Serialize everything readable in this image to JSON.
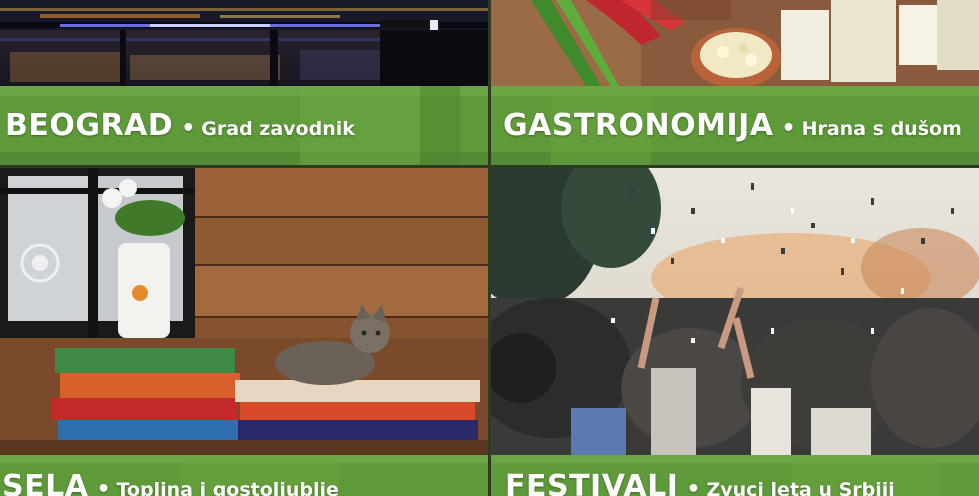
{
  "tiles": [
    {
      "title": "BEOGRAD",
      "separator": "•",
      "subtitle": "Grad zavodnik"
    },
    {
      "title": "GASTRONOMIJA",
      "separator": "•",
      "subtitle": "Hrana s dušom"
    },
    {
      "title": "SELA",
      "separator": "•",
      "subtitle": "Toplina i gostoljublje"
    },
    {
      "title": "FESTIVALI",
      "separator": "•",
      "subtitle": "Zvuci leta u Srbiji"
    }
  ],
  "colors": {
    "banner_green": "#5f9a3a",
    "banner_green_light": "#77b14c",
    "banner_green_dark": "#4b8330",
    "text": "#ffffff"
  },
  "images": {
    "beograd": "night-river-bridge-photo",
    "gastronomija": "cheese-peppers-onion-photo",
    "sela": "cat-on-woven-rugs-by-window-photo",
    "festivali": "festival-crowd-confetti-photo"
  }
}
